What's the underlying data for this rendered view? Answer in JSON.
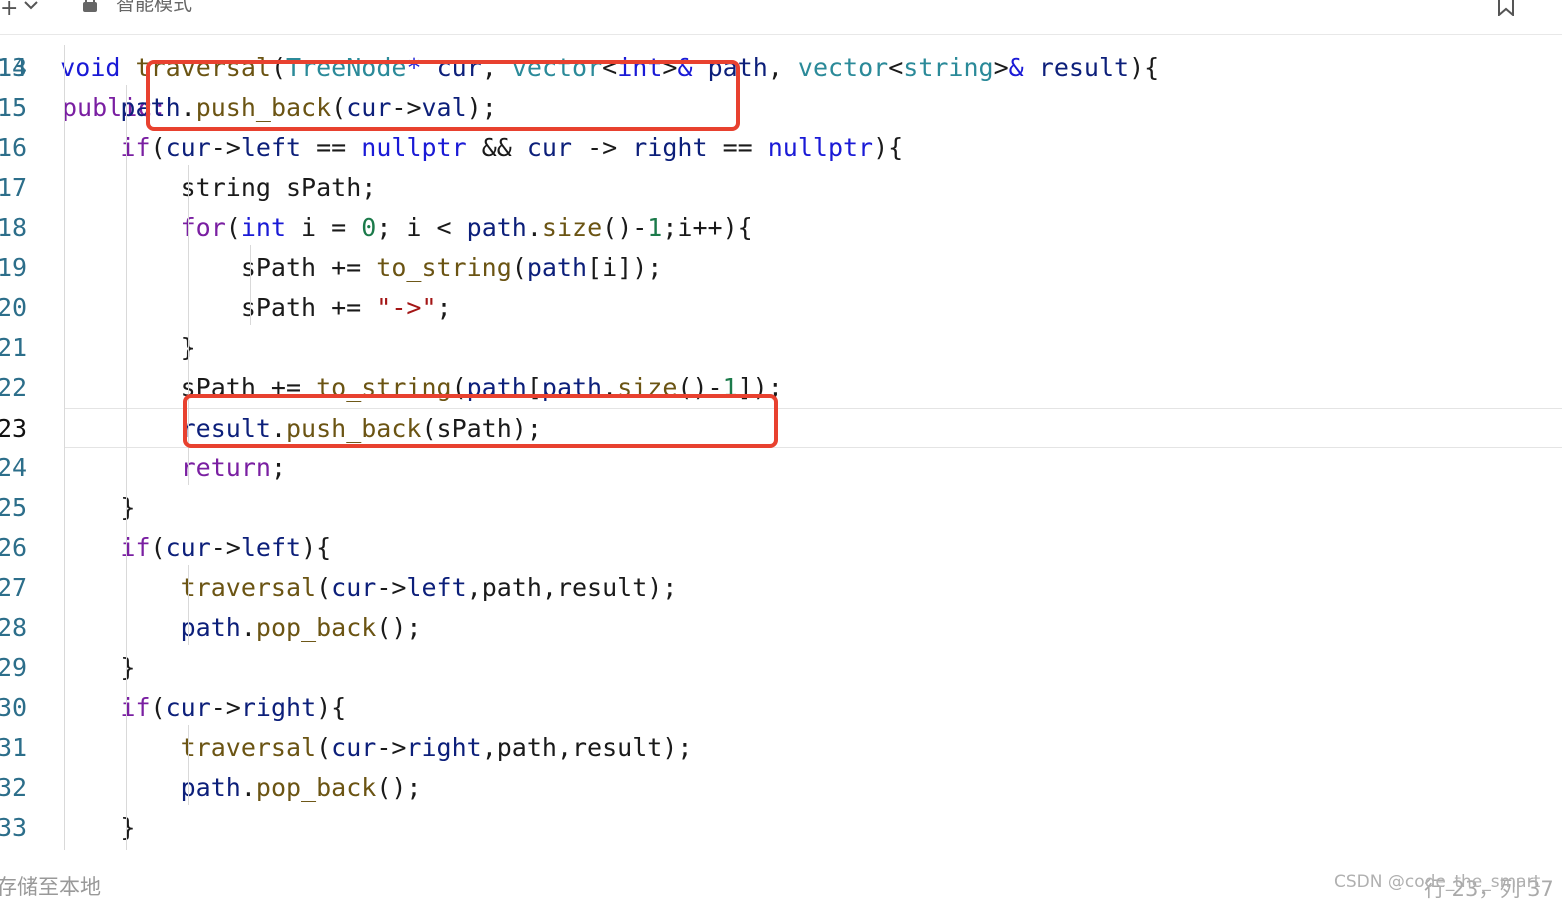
{
  "toolbar": {
    "mode_label": "智能模式",
    "icons": [
      "plus-icon",
      "chevron-down-icon",
      "lock-icon",
      "bookmark-icon"
    ]
  },
  "editor": {
    "partial_top_line": "public:",
    "lines": [
      {
        "no": "14",
        "code": [
          [
            "    ",
            "pm"
          ],
          [
            "void",
            "kt"
          ],
          [
            " ",
            "pm"
          ],
          [
            "traversal",
            "fn"
          ],
          [
            "(",
            "pm"
          ],
          [
            "TreeNode",
            "ty"
          ],
          [
            "*",
            "kt"
          ],
          [
            " ",
            "pm"
          ],
          [
            "cur",
            "id"
          ],
          [
            ", ",
            "pm"
          ],
          [
            "vector",
            "ty"
          ],
          [
            "<",
            "pm"
          ],
          [
            "int",
            "kt"
          ],
          [
            ">",
            "pm"
          ],
          [
            "&",
            "kt"
          ],
          [
            " ",
            "pm"
          ],
          [
            "path",
            "id"
          ],
          [
            ", ",
            "pm"
          ],
          [
            "vector",
            "ty"
          ],
          [
            "<",
            "pm"
          ],
          [
            "string",
            "ty"
          ],
          [
            ">",
            "pm"
          ],
          [
            "&",
            "kt"
          ],
          [
            " ",
            "pm"
          ],
          [
            "result",
            "id"
          ],
          [
            "){",
            "pm"
          ]
        ]
      },
      {
        "no": "15",
        "code": [
          [
            "        ",
            "pm"
          ],
          [
            "path",
            "id"
          ],
          [
            ".",
            "pm"
          ],
          [
            "push_back",
            "fn"
          ],
          [
            "(",
            "pm"
          ],
          [
            "cur",
            "id"
          ],
          [
            "->",
            "pm"
          ],
          [
            "val",
            "id"
          ],
          [
            ");",
            "pm"
          ]
        ]
      },
      {
        "no": "16",
        "code": [
          [
            "        ",
            "pm"
          ],
          [
            "if",
            "kw"
          ],
          [
            "(",
            "pm"
          ],
          [
            "cur",
            "id"
          ],
          [
            "->",
            "pm"
          ],
          [
            "left",
            "id"
          ],
          [
            " == ",
            "pm"
          ],
          [
            "nullptr",
            "kt"
          ],
          [
            " && ",
            "pm"
          ],
          [
            "cur",
            "id"
          ],
          [
            " -> ",
            "pm"
          ],
          [
            "right",
            "id"
          ],
          [
            " == ",
            "pm"
          ],
          [
            "nullptr",
            "kt"
          ],
          [
            "){",
            "pm"
          ]
        ]
      },
      {
        "no": "17",
        "code": [
          [
            "            ",
            "pm"
          ],
          [
            "string sPath;",
            "pm"
          ]
        ]
      },
      {
        "no": "18",
        "code": [
          [
            "            ",
            "pm"
          ],
          [
            "for",
            "kw"
          ],
          [
            "(",
            "pm"
          ],
          [
            "int",
            "kt"
          ],
          [
            " i = ",
            "pm"
          ],
          [
            "0",
            "num"
          ],
          [
            "; i < ",
            "pm"
          ],
          [
            "path",
            "id"
          ],
          [
            ".",
            "pm"
          ],
          [
            "size",
            "fn"
          ],
          [
            "()-",
            "pm"
          ],
          [
            "1",
            "num"
          ],
          [
            ";i++){",
            "pm"
          ]
        ]
      },
      {
        "no": "19",
        "code": [
          [
            "                ",
            "pm"
          ],
          [
            "sPath += ",
            "pm"
          ],
          [
            "to_string",
            "fn"
          ],
          [
            "(",
            "pm"
          ],
          [
            "path",
            "id"
          ],
          [
            "[i]);",
            "pm"
          ]
        ]
      },
      {
        "no": "20",
        "code": [
          [
            "                ",
            "pm"
          ],
          [
            "sPath += ",
            "pm"
          ],
          [
            "\"->\"",
            "str"
          ],
          [
            ";",
            "pm"
          ]
        ]
      },
      {
        "no": "21",
        "code": [
          [
            "            ",
            "pm"
          ],
          [
            "}",
            "pm"
          ]
        ]
      },
      {
        "no": "22",
        "code": [
          [
            "            ",
            "pm"
          ],
          [
            "sPath += ",
            "pm"
          ],
          [
            "to_string",
            "fn"
          ],
          [
            "(",
            "pm"
          ],
          [
            "path",
            "id"
          ],
          [
            "[",
            "pm"
          ],
          [
            "path",
            "id"
          ],
          [
            ".",
            "pm"
          ],
          [
            "size",
            "fn"
          ],
          [
            "()-",
            "pm"
          ],
          [
            "1",
            "num"
          ],
          [
            "]);",
            "pm"
          ]
        ]
      },
      {
        "no": "23",
        "code": [
          [
            "            ",
            "pm"
          ],
          [
            "result",
            "id"
          ],
          [
            ".",
            "pm"
          ],
          [
            "push_back",
            "fn"
          ],
          [
            "(sPath);",
            "pm"
          ]
        ]
      },
      {
        "no": "24",
        "code": [
          [
            "            ",
            "pm"
          ],
          [
            "return",
            "kw"
          ],
          [
            ";",
            "pm"
          ]
        ]
      },
      {
        "no": "25",
        "code": [
          [
            "        ",
            "pm"
          ],
          [
            "}",
            "pm"
          ]
        ]
      },
      {
        "no": "26",
        "code": [
          [
            "        ",
            "pm"
          ],
          [
            "if",
            "kw"
          ],
          [
            "(",
            "pm"
          ],
          [
            "cur",
            "id"
          ],
          [
            "->",
            "pm"
          ],
          [
            "left",
            "id"
          ],
          [
            "){",
            "pm"
          ]
        ]
      },
      {
        "no": "27",
        "code": [
          [
            "            ",
            "pm"
          ],
          [
            "traversal",
            "fn"
          ],
          [
            "(",
            "pm"
          ],
          [
            "cur",
            "id"
          ],
          [
            "->",
            "pm"
          ],
          [
            "left",
            "id"
          ],
          [
            ",path,result);",
            "pm"
          ]
        ]
      },
      {
        "no": "28",
        "code": [
          [
            "            ",
            "pm"
          ],
          [
            "path",
            "id"
          ],
          [
            ".",
            "pm"
          ],
          [
            "pop_back",
            "fn"
          ],
          [
            "();",
            "pm"
          ]
        ]
      },
      {
        "no": "29",
        "code": [
          [
            "        ",
            "pm"
          ],
          [
            "}",
            "pm"
          ]
        ]
      },
      {
        "no": "30",
        "code": [
          [
            "        ",
            "pm"
          ],
          [
            "if",
            "kw"
          ],
          [
            "(",
            "pm"
          ],
          [
            "cur",
            "id"
          ],
          [
            "->",
            "pm"
          ],
          [
            "right",
            "id"
          ],
          [
            "){",
            "pm"
          ]
        ]
      },
      {
        "no": "31",
        "code": [
          [
            "            ",
            "pm"
          ],
          [
            "traversal",
            "fn"
          ],
          [
            "(",
            "pm"
          ],
          [
            "cur",
            "id"
          ],
          [
            "->",
            "pm"
          ],
          [
            "right",
            "id"
          ],
          [
            ",path,result);",
            "pm"
          ]
        ]
      },
      {
        "no": "32",
        "code": [
          [
            "            ",
            "pm"
          ],
          [
            "path",
            "id"
          ],
          [
            ".",
            "pm"
          ],
          [
            "pop_back",
            "fn"
          ],
          [
            "();",
            "pm"
          ]
        ]
      },
      {
        "no": "33",
        "code": [
          [
            "        ",
            "pm"
          ],
          [
            "}",
            "pm"
          ]
        ]
      }
    ],
    "active_line": "23",
    "annotation_color": "#e8412f"
  },
  "status": {
    "left_text": "存储至本地",
    "right_text": "行 23，列 37"
  },
  "watermark": "CSDN @code_the_smart"
}
